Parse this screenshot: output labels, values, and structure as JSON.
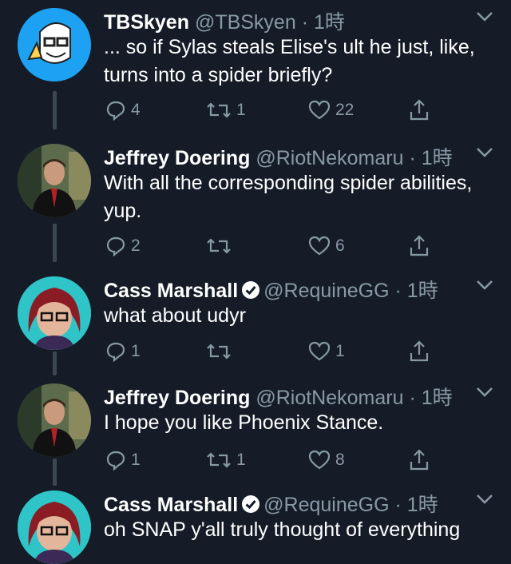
{
  "tweets": [
    {
      "name": "TBSkyen",
      "handle": "@TBSkyen",
      "time": "1時",
      "verified": false,
      "text": "... so if Sylas steals Elise's ult he just, like, turns into a spider briefly?",
      "replies": "4",
      "retweets": "1",
      "likes": "22"
    },
    {
      "name": "Jeffrey Doering",
      "handle": "@RiotNekomaru",
      "time": "1時",
      "verified": false,
      "text": "With all the corresponding spider abilities, yup.",
      "replies": "2",
      "retweets": "",
      "likes": "6"
    },
    {
      "name": "Cass Marshall",
      "handle": "@RequineGG",
      "time": "1時",
      "verified": true,
      "text": "what about udyr",
      "replies": "1",
      "retweets": "",
      "likes": "1"
    },
    {
      "name": "Jeffrey Doering",
      "handle": "@RiotNekomaru",
      "time": "1時",
      "verified": false,
      "text": "I hope you like Phoenix Stance.",
      "replies": "1",
      "retweets": "1",
      "likes": "8"
    },
    {
      "name": "Cass Marshall",
      "handle": "@RequineGG",
      "time": "1時",
      "verified": true,
      "text": "oh SNAP y'all truly thought of everything",
      "replies": "",
      "retweets": "",
      "likes": ""
    }
  ],
  "separator": "·",
  "colors": {
    "background": "#151c27",
    "secondary_text": "#8899a6",
    "thread_line": "#3d4754",
    "avatar_tbskyen_bg": "#1da1f2"
  },
  "icons": [
    "reply-icon",
    "retweet-icon",
    "like-icon",
    "share-icon",
    "chevron-down-icon",
    "verified-badge-icon"
  ]
}
